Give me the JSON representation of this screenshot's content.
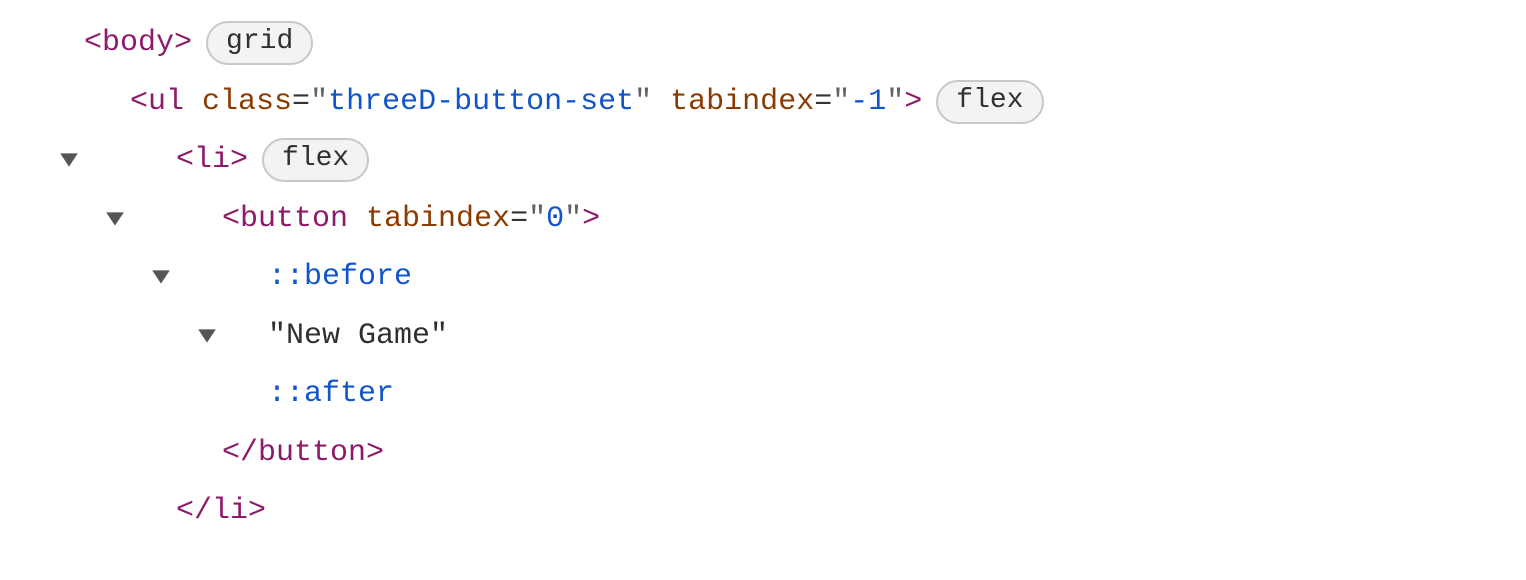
{
  "tree": {
    "row0": {
      "tag_open": "<body>",
      "badge": "grid"
    },
    "row1": {
      "tag_open_start": "<ul",
      "attr1_name": "class",
      "attr1_val": "threeD-button-set",
      "attr2_name": "tabindex",
      "attr2_val": "-1",
      "tag_open_end": ">",
      "badge": "flex"
    },
    "row2": {
      "tag_open": "<li>",
      "badge": "flex"
    },
    "row3": {
      "tag_open_start": "<button",
      "attr1_name": "tabindex",
      "attr1_val": "0",
      "tag_open_end": ">"
    },
    "row4": {
      "pseudo": "::before"
    },
    "row5": {
      "text": "\"New Game\""
    },
    "row6": {
      "pseudo": "::after"
    },
    "row7": {
      "tag_close": "</button>"
    },
    "row8": {
      "tag_close": "</li>"
    }
  }
}
